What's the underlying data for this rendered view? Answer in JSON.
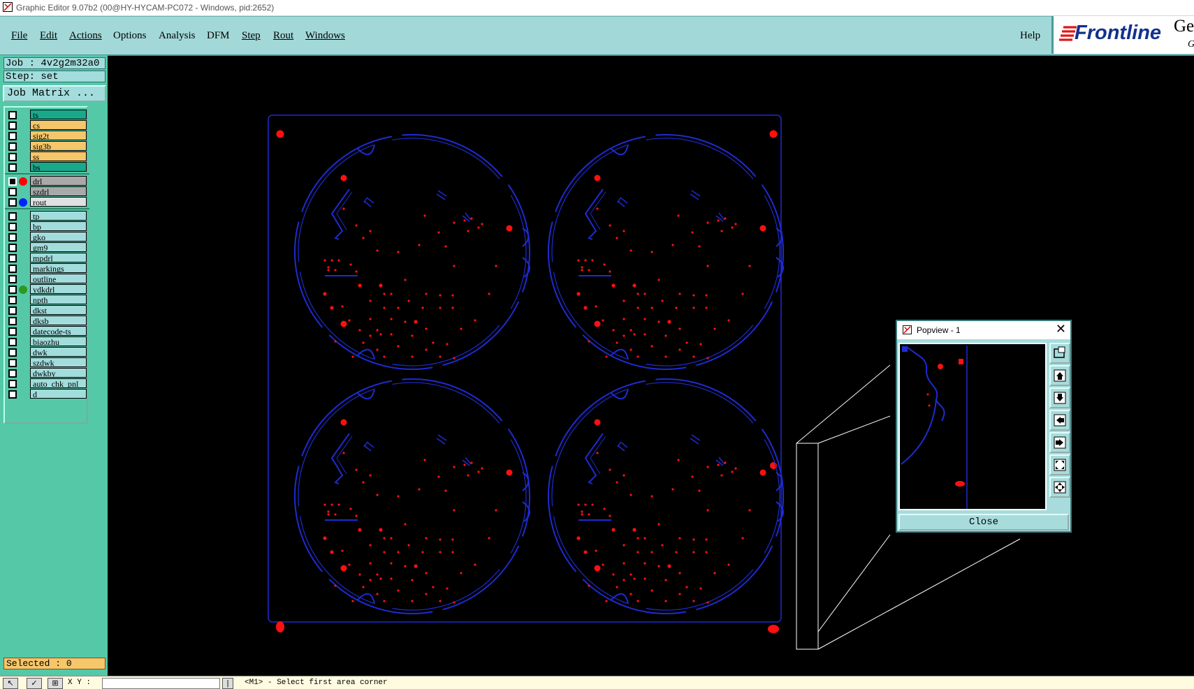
{
  "window": {
    "title": "Graphic Editor 9.07b2 (00@HY-HYCAM-PC072 - Windows, pid:2652)"
  },
  "menu": {
    "items": [
      "File",
      "Edit",
      "Actions",
      "Options",
      "Analysis",
      "DFM",
      "Step",
      "Rout",
      "Windows"
    ],
    "help": "Help"
  },
  "logo": {
    "brand": "Frontline",
    "side_text": "Ger",
    "side_text2": "G"
  },
  "job": {
    "job_label": "Job : 4v2g2m32a0",
    "step_label": "Step: set",
    "matrix_button": "Job Matrix ..."
  },
  "layers": [
    {
      "name": "ts",
      "bg": "#1aa88a",
      "dot": ""
    },
    {
      "name": "cs",
      "bg": "#f5c66a",
      "dot": ""
    },
    {
      "name": "sig2t",
      "bg": "#f5c66a",
      "dot": ""
    },
    {
      "name": "sig3b",
      "bg": "#f5c66a",
      "dot": ""
    },
    {
      "name": "ss",
      "bg": "#f5c66a",
      "dot": ""
    },
    {
      "name": "bs",
      "bg": "#1aa88a",
      "dot": ""
    },
    {
      "name": "drl",
      "bg": "#a9a9a9",
      "dot": "#ff0000",
      "active": true
    },
    {
      "name": "szdrl",
      "bg": "#a9a9a9",
      "dot": ""
    },
    {
      "name": "rout",
      "bg": "#e0e0e0",
      "dot": "#0022ff"
    },
    {
      "name": "tp",
      "bg": "#a3dcdc",
      "dot": ""
    },
    {
      "name": "bp",
      "bg": "#a3dcdc",
      "dot": ""
    },
    {
      "name": "gko",
      "bg": "#a3dcdc",
      "dot": ""
    },
    {
      "name": "gm9",
      "bg": "#a3dcdc",
      "dot": ""
    },
    {
      "name": "mpdrl",
      "bg": "#a3dcdc",
      "dot": ""
    },
    {
      "name": "markings",
      "bg": "#a3dcdc",
      "dot": ""
    },
    {
      "name": "outline",
      "bg": "#a3dcdc",
      "dot": ""
    },
    {
      "name": "ydkdrl",
      "bg": "#a3dcdc",
      "dot": "#2a9a20"
    },
    {
      "name": "npth",
      "bg": "#a3dcdc",
      "dot": ""
    },
    {
      "name": "dkst",
      "bg": "#a3dcdc",
      "dot": ""
    },
    {
      "name": "dksb",
      "bg": "#a3dcdc",
      "dot": ""
    },
    {
      "name": "datecode-ts",
      "bg": "#a3dcdc",
      "dot": ""
    },
    {
      "name": "biaozhu",
      "bg": "#a3dcdc",
      "dot": ""
    },
    {
      "name": "dwk",
      "bg": "#a3dcdc",
      "dot": ""
    },
    {
      "name": "szdwk",
      "bg": "#a3dcdc",
      "dot": ""
    },
    {
      "name": "dwkby",
      "bg": "#a3dcdc",
      "dot": ""
    },
    {
      "name": "auto_chk_pnl",
      "bg": "#a3dcdc",
      "dot": ""
    },
    {
      "name": "d",
      "bg": "#a3dcdc",
      "dot": ""
    }
  ],
  "selected": "Selected : 0",
  "status": {
    "xy_label": "X Y :",
    "message": "<M1> - Select first area corner"
  },
  "popview": {
    "title": "Popview - 1",
    "close_button": "Close"
  },
  "colors": {
    "rout": "#1f2bd0",
    "drill": "#ff1010",
    "panel": "#a3d8d8",
    "accent": "#55c8a8"
  }
}
